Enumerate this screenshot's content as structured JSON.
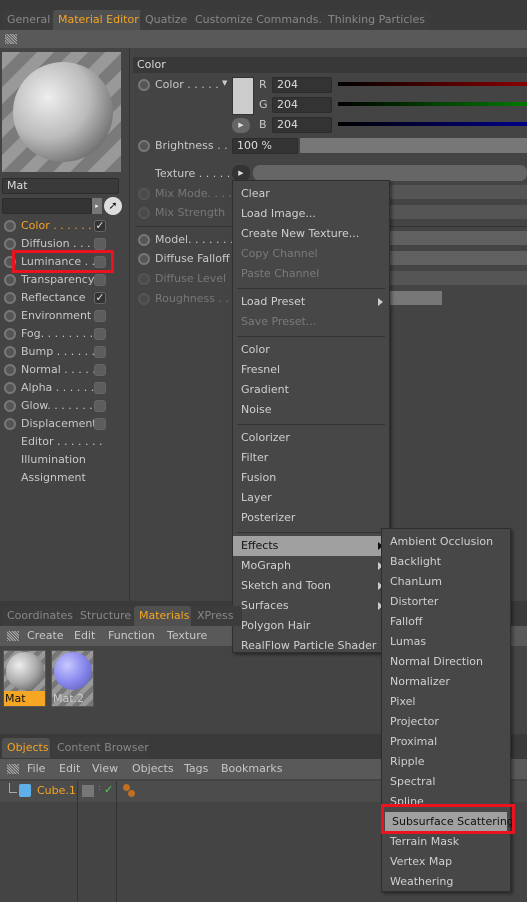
{
  "top_tabs": [
    {
      "label": "General"
    },
    {
      "label": "Material Editor",
      "active": true
    },
    {
      "label": "Quatize"
    },
    {
      "label": "Customize Commands..."
    },
    {
      "label": "Thinking Particles"
    }
  ],
  "material": {
    "name": "Mat"
  },
  "channels": [
    {
      "label": "Color . . . . . .",
      "checked": true,
      "active": true
    },
    {
      "label": "Diffusion . . .",
      "checked": false
    },
    {
      "label": "Luminance . .",
      "checked": false
    },
    {
      "label": "Transparency",
      "checked": false
    },
    {
      "label": "Reflectance",
      "checked": true
    },
    {
      "label": "Environment",
      "checked": false
    },
    {
      "label": "Fog. . . . . . . . .",
      "checked": false
    },
    {
      "label": "Bump . . . . . . .",
      "checked": false
    },
    {
      "label": "Normal . . . . . .",
      "checked": false
    },
    {
      "label": "Alpha . . . . . . .",
      "checked": false
    },
    {
      "label": "Glow. . . . . . . .",
      "checked": false
    },
    {
      "label": "Displacement",
      "checked": false
    }
  ],
  "extra_channels": [
    {
      "label": "Editor . . . . . . ."
    },
    {
      "label": "Illumination"
    },
    {
      "label": "Assignment"
    }
  ],
  "color_section": {
    "header": "Color",
    "color_label": "Color . . . . .",
    "r_label": "R",
    "g_label": "G",
    "b_label": "B",
    "r": "204",
    "g": "204",
    "b": "204",
    "swatch": "#cccccc",
    "brightness_label": "Brightness . . .",
    "brightness": "100 %",
    "texture_label": "Texture . . . . . .",
    "mix_mode_label": "Mix Mode. . . .",
    "mix_strength_label": "Mix Strength",
    "model_label": "Model. . . . . . . .",
    "diffuse_falloff_label": "Diffuse Falloff",
    "diffuse_level_label": "Diffuse Level",
    "roughness_label": "Roughness . ."
  },
  "context_menu": {
    "groups": [
      [
        {
          "label": "Clear"
        },
        {
          "label": "Load Image..."
        },
        {
          "label": "Create New Texture..."
        },
        {
          "label": "Copy Channel",
          "disabled": true
        },
        {
          "label": "Paste Channel",
          "disabled": true
        }
      ],
      [
        {
          "label": "Load Preset",
          "submenu": true
        },
        {
          "label": "Save Preset...",
          "disabled": true
        }
      ],
      [
        {
          "label": "Color"
        },
        {
          "label": "Fresnel"
        },
        {
          "label": "Gradient"
        },
        {
          "label": "Noise"
        }
      ],
      [
        {
          "label": "Colorizer"
        },
        {
          "label": "Filter"
        },
        {
          "label": "Fusion"
        },
        {
          "label": "Layer"
        },
        {
          "label": "Posterizer"
        }
      ],
      [
        {
          "label": "Effects",
          "submenu": true,
          "highlighted": true
        },
        {
          "label": "MoGraph",
          "submenu": true
        },
        {
          "label": "Sketch and Toon",
          "submenu": true
        },
        {
          "label": "Surfaces",
          "submenu": true
        },
        {
          "label": "Polygon Hair"
        },
        {
          "label": "RealFlow Particle Shader"
        }
      ]
    ]
  },
  "effects_submenu": [
    {
      "label": "Ambient Occlusion"
    },
    {
      "label": "Backlight"
    },
    {
      "label": "ChanLum"
    },
    {
      "label": "Distorter"
    },
    {
      "label": "Falloff"
    },
    {
      "label": "Lumas"
    },
    {
      "label": "Normal Direction"
    },
    {
      "label": "Normalizer"
    },
    {
      "label": "Pixel"
    },
    {
      "label": "Projector"
    },
    {
      "label": "Proximal"
    },
    {
      "label": "Ripple"
    },
    {
      "label": "Spectral"
    },
    {
      "label": "Spline"
    },
    {
      "label": "Subsurface Scattering",
      "highlighted": true
    },
    {
      "label": "Terrain Mask"
    },
    {
      "label": "Vertex Map"
    },
    {
      "label": "Weathering"
    }
  ],
  "materials_panel": {
    "tabs": [
      {
        "label": "Coordinates"
      },
      {
        "label": "Structure"
      },
      {
        "label": "Materials",
        "active": true
      },
      {
        "label": "XPress"
      }
    ],
    "menu": [
      "Create",
      "Edit",
      "Function",
      "Texture"
    ],
    "materials": [
      {
        "name": "Mat",
        "selected": true
      },
      {
        "name": "Mat.2"
      }
    ]
  },
  "objects_panel": {
    "tabs": [
      {
        "label": "Objects",
        "active": true
      },
      {
        "label": "Content Browser"
      }
    ],
    "menu": [
      "File",
      "Edit",
      "View",
      "Objects",
      "Tags",
      "Bookmarks"
    ],
    "objects": [
      {
        "name": "Cube.1"
      }
    ]
  },
  "colors": {
    "accent": "#f5a623",
    "highlight_box": "#e8151f"
  }
}
